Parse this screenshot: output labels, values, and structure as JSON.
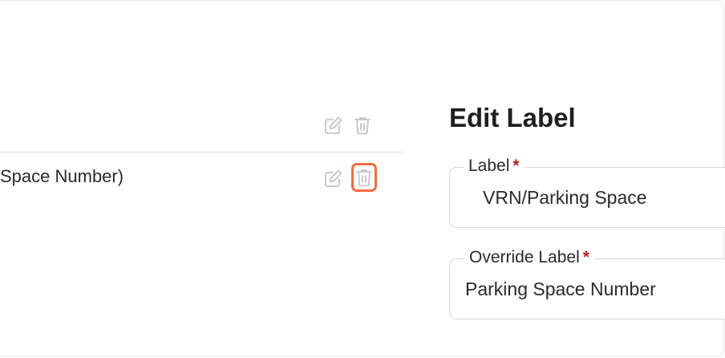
{
  "list": {
    "row": {
      "text": "Space Number)"
    },
    "header_actions": {
      "edit_icon": "edit-icon",
      "delete_icon": "trash-icon"
    },
    "row_actions": {
      "edit_icon": "edit-icon",
      "delete_icon": "trash-icon"
    }
  },
  "edit_panel": {
    "title": "Edit Label",
    "fields": [
      {
        "label": "Label",
        "required_mark": "*",
        "value": "VRN/Parking Space"
      },
      {
        "label": "Override Label",
        "required_mark": "*",
        "value": "Parking Space Number"
      }
    ]
  },
  "colors": {
    "highlight": "#f16b3f",
    "required": "#b3251e",
    "icon": "#c4c4c4"
  }
}
